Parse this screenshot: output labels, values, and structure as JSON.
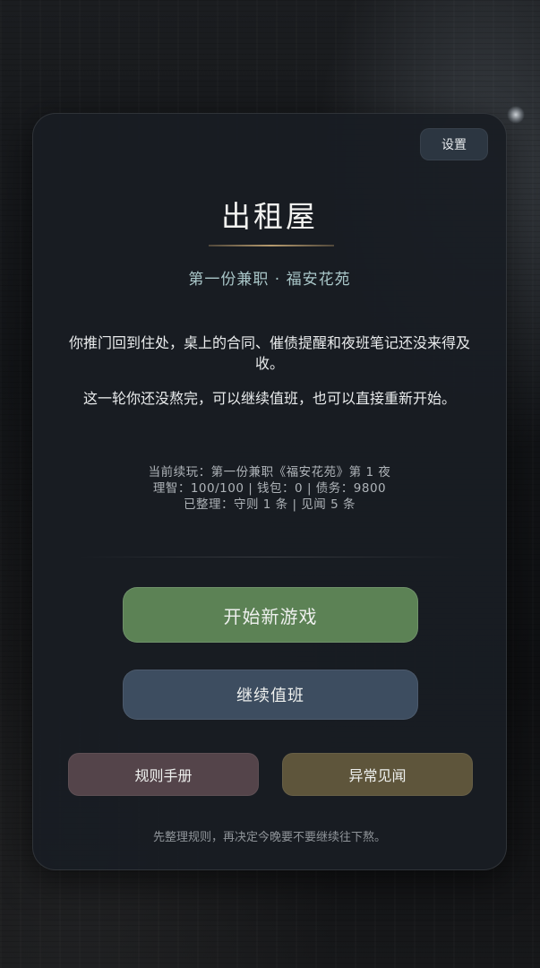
{
  "header": {
    "settings_label": "设置"
  },
  "main": {
    "title": "出租屋",
    "subtitle": "第一份兼职 · 福安花苑",
    "paragraphs": [
      "你推门回到住处，桌上的合同、催债提醒和夜班笔记还没来得及收。",
      "这一轮你还没熬完，可以继续值班，也可以直接重新开始。"
    ],
    "status_lines": [
      "当前续玩：第一份兼职《福安花苑》第 1 夜",
      "理智：100/100 | 钱包：0 | 债务：9800",
      "已整理：守则 1 条 | 见闻 5 条"
    ]
  },
  "actions": {
    "new_game_label": "开始新游戏",
    "continue_label": "继续值班",
    "rules_label": "规则手册",
    "anomaly_label": "异常见闻"
  },
  "footer": {
    "hint": "先整理规则，再决定今晚要不要继续往下熬。"
  },
  "colors": {
    "panel_bg": "#181d23",
    "new_game_button": "#5c8255",
    "continue_button": "#3d4d60",
    "rules_button": "#54444a",
    "anomaly_button": "#5e553b",
    "subtitle_text": "#a9c6c8",
    "title_rule_accent": "#b59a6e"
  }
}
